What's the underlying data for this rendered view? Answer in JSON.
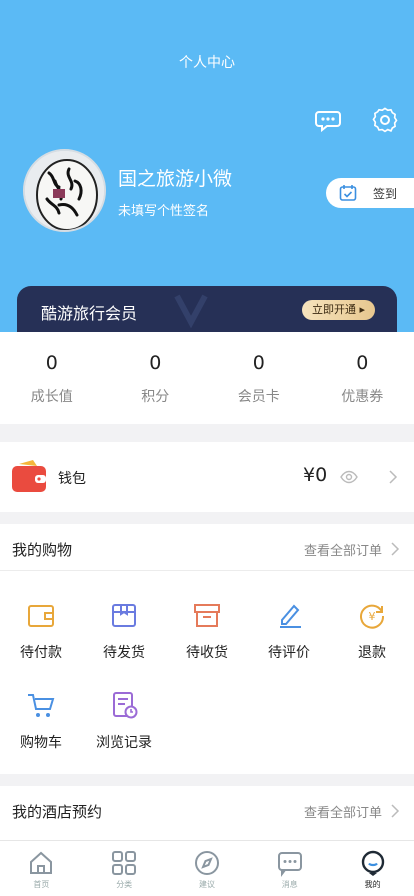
{
  "header": {
    "title": "个人中心"
  },
  "profile": {
    "username": "国之旅游小微",
    "signature": "未填写个性签名",
    "checkin_label": "签到"
  },
  "vip": {
    "title": "酷游旅行会员",
    "button": "立即开通 ▸"
  },
  "stats": [
    {
      "value": "0",
      "label": "成长值"
    },
    {
      "value": "0",
      "label": "积分"
    },
    {
      "value": "0",
      "label": "会员卡"
    },
    {
      "value": "0",
      "label": "优惠券"
    }
  ],
  "wallet": {
    "label": "钱包",
    "amount": "¥0"
  },
  "shopping": {
    "title": "我的购物",
    "link": "查看全部订单",
    "items": [
      {
        "label": "待付款",
        "icon": "wallet-outline-icon",
        "color": "#e8a73a"
      },
      {
        "label": "待发货",
        "icon": "box-outline-icon",
        "color": "#6a7be0"
      },
      {
        "label": "待收货",
        "icon": "package-outline-icon",
        "color": "#e57a5a"
      },
      {
        "label": "待评价",
        "icon": "pen-icon",
        "color": "#4a90e2"
      },
      {
        "label": "退款",
        "icon": "refund-icon",
        "color": "#e8a73a"
      },
      {
        "label": "购物车",
        "icon": "cart-icon",
        "color": "#4a90e2"
      },
      {
        "label": "浏览记录",
        "icon": "history-icon",
        "color": "#9b6bd6"
      }
    ]
  },
  "hotel": {
    "title": "我的酒店预约",
    "link": "查看全部订单"
  },
  "tabbar": [
    {
      "label": "首页",
      "icon": "home-icon"
    },
    {
      "label": "分类",
      "icon": "grid-icon"
    },
    {
      "label": "建议",
      "icon": "compass-icon"
    },
    {
      "label": "消息",
      "icon": "message-icon"
    },
    {
      "label": "我的",
      "icon": "profile-icon",
      "active": true
    }
  ]
}
